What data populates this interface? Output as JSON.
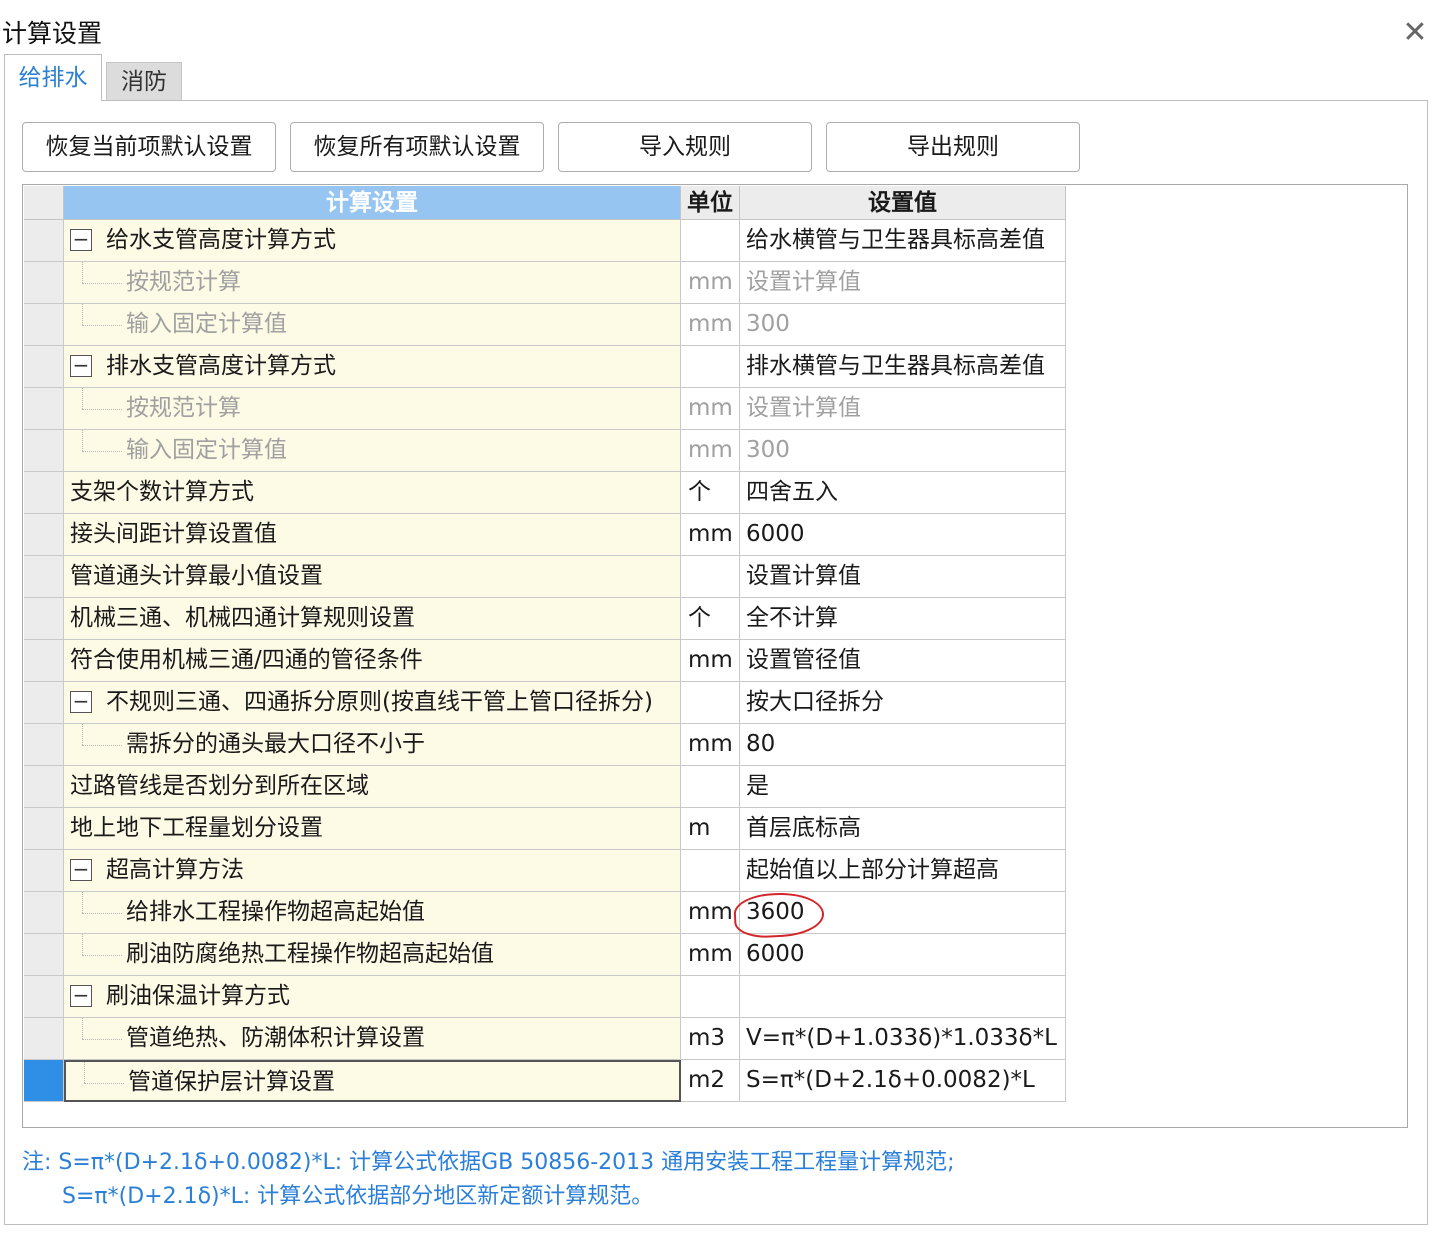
{
  "dialog": {
    "title": "计算设置",
    "close_glyph": "✕"
  },
  "tabs": [
    {
      "label": "给排水",
      "active": true
    },
    {
      "label": "消防",
      "active": false
    }
  ],
  "toolbar": {
    "restore_current": "恢复当前项默认设置",
    "restore_all": "恢复所有项默认设置",
    "import_rules": "导入规则",
    "export_rules": "导出规则"
  },
  "table": {
    "headers": {
      "name": "计算设置",
      "unit": "单位",
      "value": "设置值"
    },
    "rows": [
      {
        "name": "给水支管高度计算方式",
        "unit": "",
        "value": "给水横管与卫生器具标高差值",
        "kind": "group"
      },
      {
        "name": "按规范计算",
        "unit": "mm",
        "value": "设置计算值",
        "kind": "child",
        "disabled": true
      },
      {
        "name": "输入固定计算值",
        "unit": "mm",
        "value": "300",
        "kind": "child",
        "disabled": true
      },
      {
        "name": "排水支管高度计算方式",
        "unit": "",
        "value": "排水横管与卫生器具标高差值",
        "kind": "group"
      },
      {
        "name": "按规范计算",
        "unit": "mm",
        "value": "设置计算值",
        "kind": "child",
        "disabled": true
      },
      {
        "name": "输入固定计算值",
        "unit": "mm",
        "value": "300",
        "kind": "child",
        "disabled": true
      },
      {
        "name": "支架个数计算方式",
        "unit": "个",
        "value": "四舍五入",
        "kind": "plain"
      },
      {
        "name": "接头间距计算设置值",
        "unit": "mm",
        "value": "6000",
        "kind": "plain"
      },
      {
        "name": "管道通头计算最小值设置",
        "unit": "",
        "value": "设置计算值",
        "kind": "plain"
      },
      {
        "name": "机械三通、机械四通计算规则设置",
        "unit": "个",
        "value": "全不计算",
        "kind": "plain"
      },
      {
        "name": "符合使用机械三通/四通的管径条件",
        "unit": "mm",
        "value": "设置管径值",
        "kind": "plain"
      },
      {
        "name": "不规则三通、四通拆分原则(按直线干管上管口径拆分)",
        "unit": "",
        "value": "按大口径拆分",
        "kind": "group"
      },
      {
        "name": "需拆分的通头最大口径不小于",
        "unit": "mm",
        "value": "80",
        "kind": "child"
      },
      {
        "name": "过路管线是否划分到所在区域",
        "unit": "",
        "value": "是",
        "kind": "plain"
      },
      {
        "name": "地上地下工程量划分设置",
        "unit": "m",
        "value": "首层底标高",
        "kind": "plain"
      },
      {
        "name": "超高计算方法",
        "unit": "",
        "value": "起始值以上部分计算超高",
        "kind": "group"
      },
      {
        "name": "给排水工程操作物超高起始值",
        "unit": "mm",
        "value": "3600",
        "kind": "child",
        "annotated": true
      },
      {
        "name": "刷油防腐绝热工程操作物超高起始值",
        "unit": "mm",
        "value": "6000",
        "kind": "child"
      },
      {
        "name": "刷油保温计算方式",
        "unit": "",
        "value": "",
        "kind": "group"
      },
      {
        "name": "管道绝热、防潮体积计算设置",
        "unit": "m3",
        "value": "V=π*(D+1.033δ)*1.033δ*L",
        "kind": "child"
      },
      {
        "name": "管道保护层计算设置",
        "unit": "m2",
        "value": "S=π*(D+2.1δ+0.0082)*L",
        "kind": "child",
        "selected": true
      }
    ]
  },
  "notes": {
    "line1": "注: S=π*(D+2.1δ+0.0082)*L: 计算公式依据GB 50856-2013 通用安装工程工程量计算规范;",
    "line2": "S=π*(D+2.1δ)*L: 计算公式依据部分地区新定额计算规范。"
  },
  "colors": {
    "accent": "#2d7fd4",
    "name_cell_bg": "#fdfae6",
    "header_bg": "#96c5f2",
    "selected_marker": "#2f8fe6",
    "annotation": "#d3262a"
  }
}
